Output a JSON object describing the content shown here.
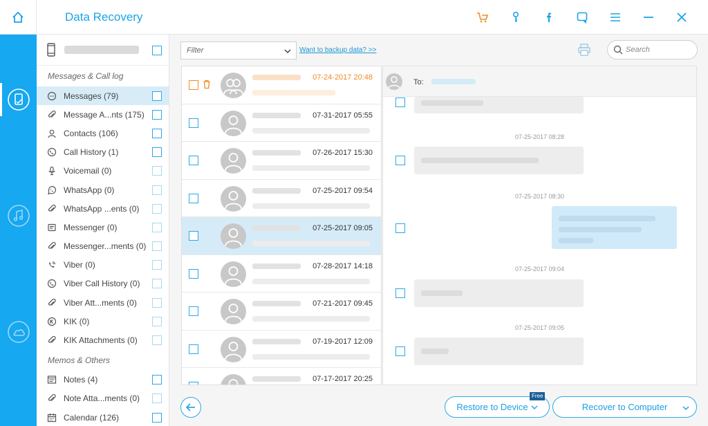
{
  "titlebar": {
    "app_title": "Data Recovery",
    "icons": [
      "home-icon",
      "cart-icon",
      "key-icon",
      "facebook-icon",
      "feedback-icon",
      "menu-icon",
      "minimize-icon",
      "close-icon"
    ]
  },
  "rail": {
    "items": [
      {
        "name": "device-recovery-icon",
        "active": true
      },
      {
        "name": "itunes-recovery-icon",
        "active": false
      },
      {
        "name": "icloud-recovery-icon",
        "active": false
      }
    ]
  },
  "sidebar": {
    "sections": [
      {
        "label": "Messages & Call log",
        "items": [
          {
            "label": "Messages (79)",
            "icon": "chat-bubble-icon",
            "selected": true,
            "checkbox_dim": false
          },
          {
            "label": "Message A...nts (175)",
            "icon": "paperclip-icon",
            "selected": false,
            "checkbox_dim": false
          },
          {
            "label": "Contacts (106)",
            "icon": "person-icon",
            "selected": false,
            "checkbox_dim": false
          },
          {
            "label": "Call History (1)",
            "icon": "phone-bubble-icon",
            "selected": false,
            "checkbox_dim": false
          },
          {
            "label": "Voicemail (0)",
            "icon": "microphone-icon",
            "selected": false,
            "checkbox_dim": true
          },
          {
            "label": "WhatsApp (0)",
            "icon": "whatsapp-icon",
            "selected": false,
            "checkbox_dim": true
          },
          {
            "label": "WhatsApp ...ents (0)",
            "icon": "paperclip-icon",
            "selected": false,
            "checkbox_dim": true
          },
          {
            "label": "Messenger (0)",
            "icon": "messenger-icon",
            "selected": false,
            "checkbox_dim": true
          },
          {
            "label": "Messenger...ments (0)",
            "icon": "paperclip-icon",
            "selected": false,
            "checkbox_dim": true
          },
          {
            "label": "Viber (0)",
            "icon": "viber-icon",
            "selected": false,
            "checkbox_dim": true
          },
          {
            "label": "Viber Call History (0)",
            "icon": "phone-bubble-icon",
            "selected": false,
            "checkbox_dim": true
          },
          {
            "label": "Viber Att...ments (0)",
            "icon": "paperclip-icon",
            "selected": false,
            "checkbox_dim": true
          },
          {
            "label": "KIK (0)",
            "icon": "kik-icon",
            "selected": false,
            "checkbox_dim": true
          },
          {
            "label": "KIK Attachments (0)",
            "icon": "paperclip-icon",
            "selected": false,
            "checkbox_dim": true
          }
        ]
      },
      {
        "label": "Memos & Others",
        "items": [
          {
            "label": "Notes (4)",
            "icon": "notes-icon",
            "selected": false,
            "checkbox_dim": false
          },
          {
            "label": "Note Atta...ments (0)",
            "icon": "paperclip-icon",
            "selected": false,
            "checkbox_dim": true
          },
          {
            "label": "Calendar (126)",
            "icon": "calendar-icon",
            "selected": false,
            "checkbox_dim": false
          }
        ]
      }
    ]
  },
  "toolbar": {
    "filter_placeholder": "Filter",
    "backup_link": "Want to backup data? >>",
    "search_placeholder": "Search"
  },
  "message_list": [
    {
      "date": "07-24-2017 20:48",
      "deleted": true,
      "selected": false
    },
    {
      "date": "07-31-2017 05:55",
      "deleted": false,
      "selected": false
    },
    {
      "date": "07-26-2017 15:30",
      "deleted": false,
      "selected": false
    },
    {
      "date": "07-25-2017 09:54",
      "deleted": false,
      "selected": false
    },
    {
      "date": "07-25-2017 09:05",
      "deleted": false,
      "selected": true
    },
    {
      "date": "07-28-2017 14:18",
      "deleted": false,
      "selected": false
    },
    {
      "date": "07-21-2017 09:45",
      "deleted": false,
      "selected": false
    },
    {
      "date": "07-19-2017 12:09",
      "deleted": false,
      "selected": false
    },
    {
      "date": "07-17-2017 20:25",
      "deleted": false,
      "selected": false
    }
  ],
  "conversation": {
    "to_label": "To:",
    "timestamps": [
      "07-25-2017 08:28",
      "07-25-2017 08:30",
      "07-25-2017 09:04",
      "07-25-2017 09:05"
    ]
  },
  "footer": {
    "restore_label": "Restore to Device",
    "free_badge": "Free",
    "recover_label": "Recover to Computer"
  },
  "colors": {
    "accent": "#16a8f0",
    "deleted": "#f08a24"
  }
}
